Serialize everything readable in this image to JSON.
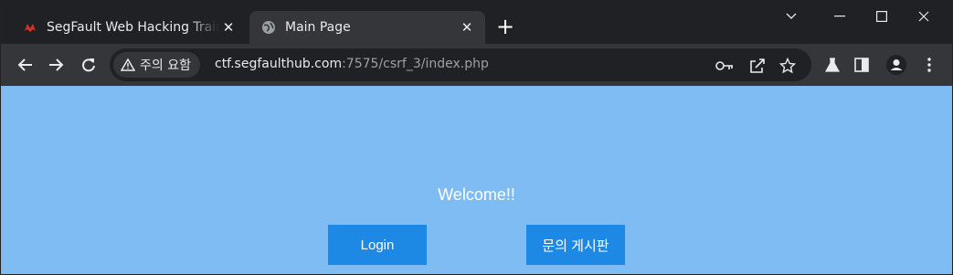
{
  "browser": {
    "tabs": [
      {
        "title": "SegFault Web Hacking Traini",
        "favicon": "segfault-favicon",
        "active": false
      },
      {
        "title": "Main Page",
        "favicon": "globe-icon",
        "active": true
      }
    ],
    "security_chip": "주의 요함",
    "url_host": "ctf.segfaulthub.com",
    "url_path": ":7575/csrf_3/index.php"
  },
  "page": {
    "welcome": "Welcome!!",
    "login_label": "Login",
    "board_label": "문의 게시판"
  },
  "colors": {
    "page_bg": "#7fbcf3",
    "button_bg": "#1e88e5",
    "chrome_dark": "#202124",
    "chrome_toolbar": "#35363a"
  }
}
